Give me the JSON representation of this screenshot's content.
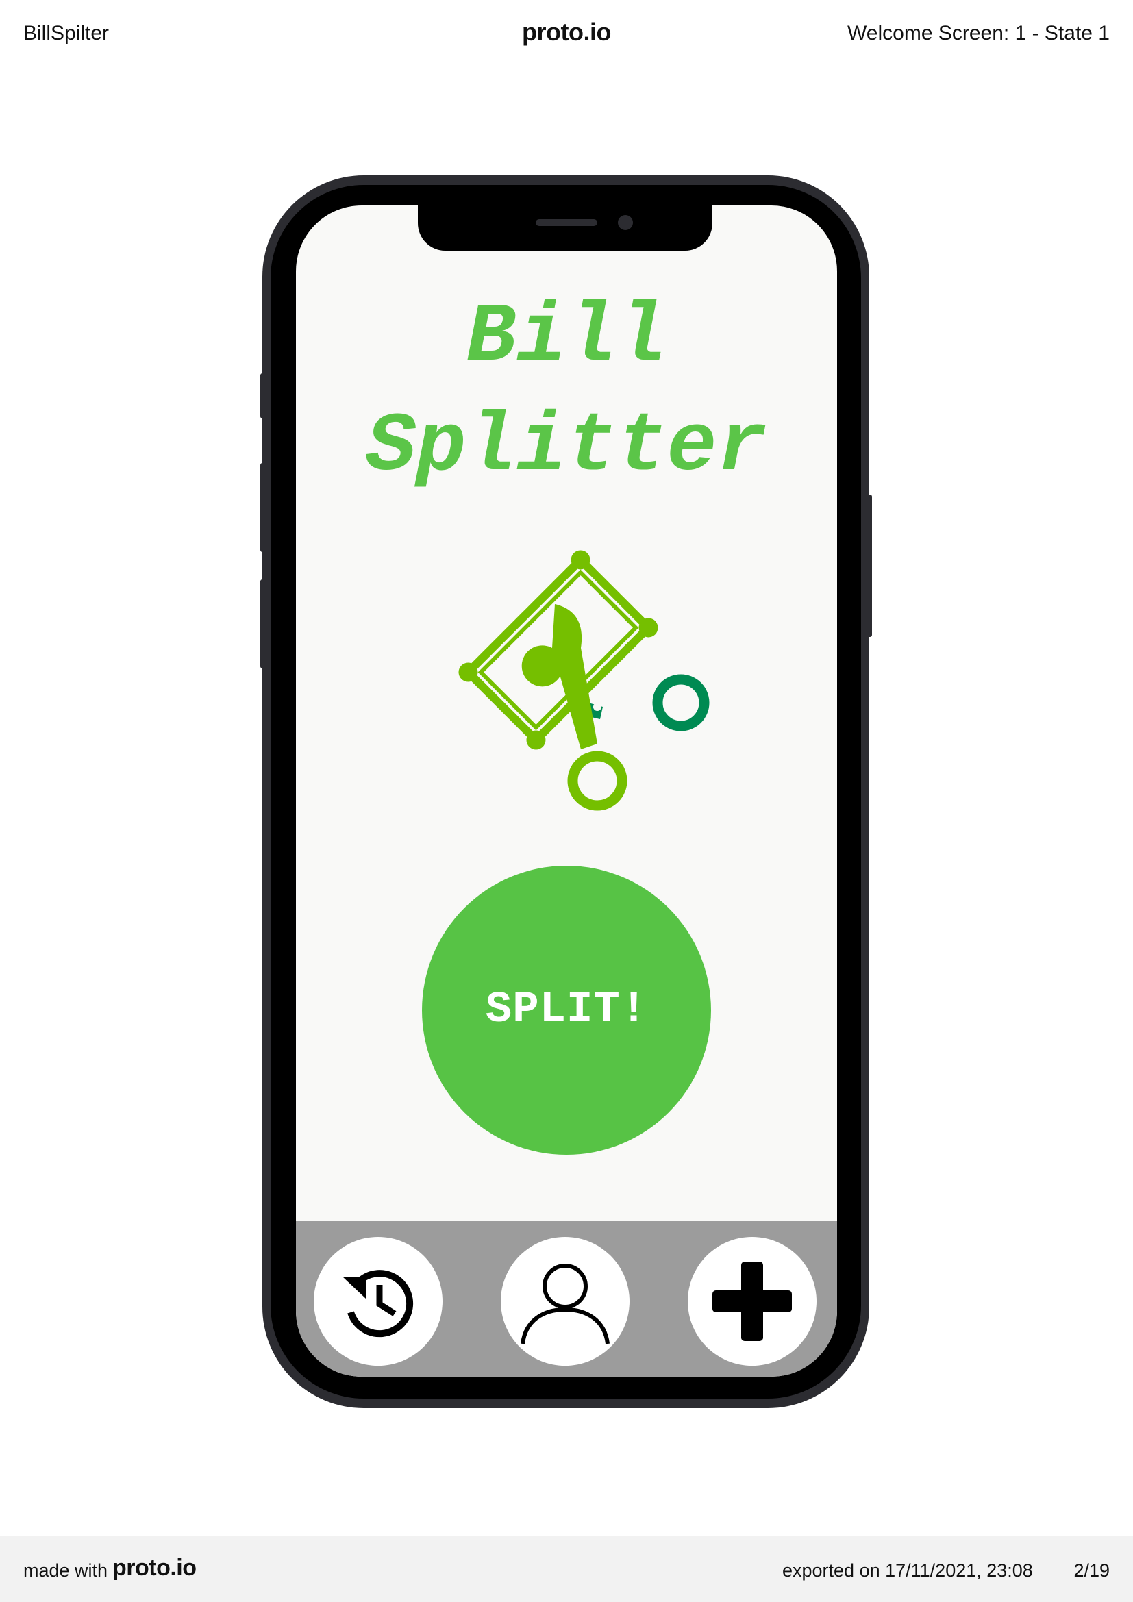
{
  "header": {
    "project_name": "BillSpilter",
    "brand": "proto.io",
    "screen_name": "Welcome Screen: 1 - State 1"
  },
  "app": {
    "title_line1": "Bill",
    "title_line2": "Splitter",
    "split_label": "SPLIT!",
    "nav": {
      "history_icon": "history-icon",
      "profile_icon": "user-icon",
      "add_icon": "plus-icon"
    },
    "colors": {
      "title_green": "#5bc548",
      "split_green": "#57c345",
      "logo_green": "#75bf00",
      "scissors_dark_green": "#008a52",
      "nav_bar_gray": "#9c9c9c"
    }
  },
  "footer": {
    "made_with": "made with",
    "brand": "proto.io",
    "exported": "exported on 17/11/2021, 23:08",
    "page": "2/19"
  }
}
